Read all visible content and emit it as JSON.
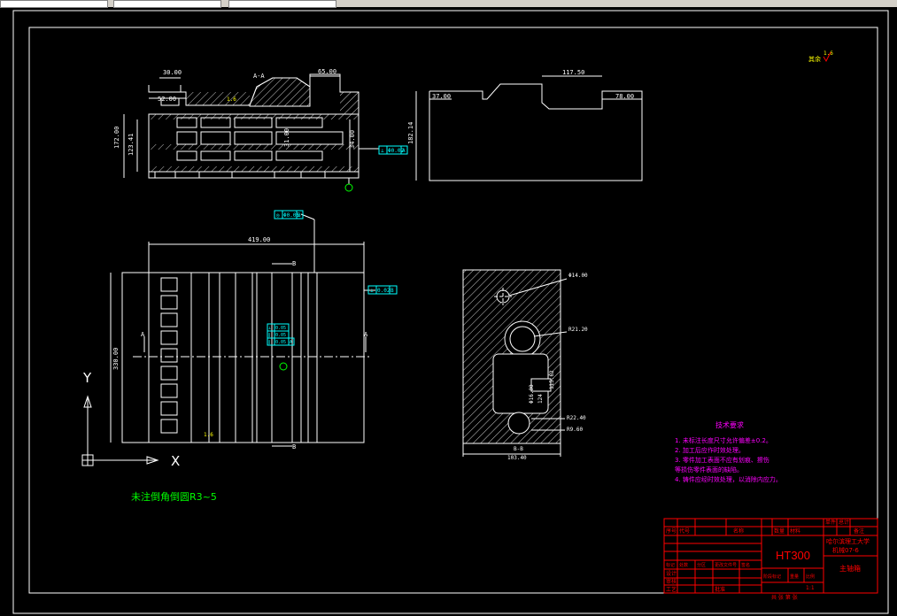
{
  "colors": {
    "background": "#000000",
    "outline": "#ffffff",
    "dimension": "#ffffff",
    "title_block": "#ff0000",
    "notes": "#ff00ff",
    "tolerance": "#00ffff",
    "axis": "#ffffff",
    "green_note": "#00ff00",
    "roughness": "#ffff00"
  },
  "icons": [
    "ucs-axis-icon",
    "roughness-symbol-icon",
    "datum-symbol-icon"
  ],
  "section_labels": {
    "aa": "A-A",
    "bb": "B-B",
    "a": "A",
    "b": "B"
  },
  "front_view_dims": {
    "w30": "30.00",
    "w52": "52.00",
    "w65": "65.00",
    "h172": "172.00",
    "h123": "123.41",
    "h31": "31.00",
    "h34": "34.00",
    "rough": "1.6"
  },
  "side_view_dims": {
    "w117": "117.50",
    "w37": "37.00",
    "w78": "78.00",
    "h182": "182.14"
  },
  "plan_view_dims": {
    "w419": "419.00",
    "h330": "330.00",
    "rough": "1.6"
  },
  "section_view_dims": {
    "d14": "Φ14.00",
    "r21": "R21.20",
    "h115": "115.62",
    "d16": "Φ16.00",
    "r22": "R22.40",
    "r9": "R9.60",
    "w103": "103.40",
    "r124": "124"
  },
  "tolerances": {
    "fcf1": [
      "⊥",
      "Φ0.02",
      "A"
    ],
    "fcf2": [
      "◎",
      "Φ0.05",
      "B"
    ],
    "fcf3": [
      "⊥",
      "0.02",
      "B"
    ],
    "fcf4": [
      "⊥",
      "0.05"
    ],
    "fcf5": [
      "∥",
      "0.05"
    ],
    "fcf6": [
      "∥",
      "0.05",
      "A"
    ]
  },
  "axis_labels": {
    "x": "X",
    "y": "Y"
  },
  "fillet_note": "未注倒角倒圆R3~5",
  "roughness_other": {
    "label": "其余",
    "value": "1.6"
  },
  "notes": {
    "title": "技术要求",
    "lines": [
      "1. 未标注长度尺寸允许偏差±0.2。",
      "2. 加工后应作时效处理。",
      "3. 零件加工表面不应有划痕、擦伤",
      "等损伤零件表面的缺陷。",
      "4. 铸件应经时效处理，以消除内应力。"
    ]
  },
  "title_block": {
    "material": "HT300",
    "school": "哈尔滨理工大学",
    "drawing_no": "机械07-6",
    "part_name": "主轴箱",
    "scale": "1:1",
    "header": [
      "序号",
      "代号",
      "名称",
      "数量",
      "材料",
      "单件",
      "总计",
      "备注"
    ],
    "header_row": [
      "标记",
      "处数",
      "分区",
      "更改文件号",
      "签名",
      "年月日"
    ],
    "rows": [
      "设计",
      "审核",
      "工艺",
      "批准"
    ],
    "mid_labels": [
      "阶段标记",
      "重量",
      "比例"
    ],
    "footer": "共 张 第 张"
  }
}
